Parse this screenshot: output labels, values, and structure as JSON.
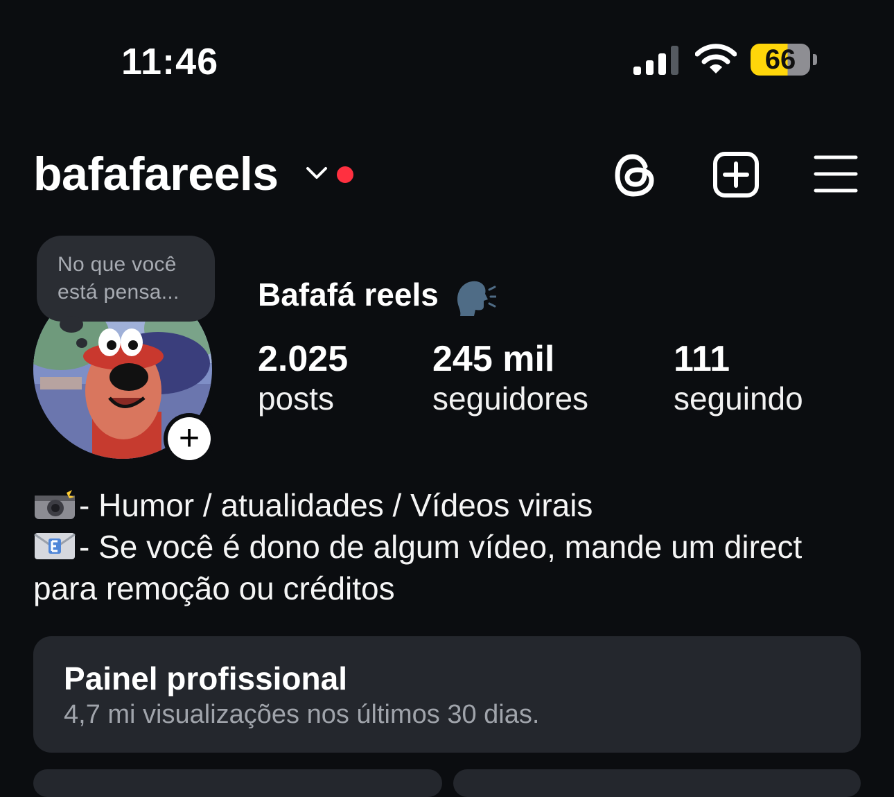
{
  "status_bar": {
    "time": "11:46",
    "battery_level": "66",
    "signal_icon": "cellular-signal-icon",
    "wifi_icon": "wifi-icon"
  },
  "header": {
    "username": "bafafareels",
    "icons": [
      "chevron-down-icon",
      "threads-icon",
      "create-post-icon",
      "menu-icon"
    ],
    "notification_color": "#ff3040"
  },
  "profile": {
    "note_line1": "No que você",
    "note_line2": "está pensa...",
    "display_name": "Bafafá reels",
    "stats": [
      {
        "value": "2.025",
        "label": "posts"
      },
      {
        "value": "245 mil",
        "label": "seguidores"
      },
      {
        "value": "111",
        "label": "seguindo"
      }
    ]
  },
  "bio": {
    "line1": "- Humor / atualidades / Vídeos virais",
    "line2": "- Se você é dono de algum vídeo, mande um direct",
    "line3": "para remoção ou créditos"
  },
  "professional_dashboard": {
    "title": "Painel profissional",
    "subtitle": "4,7 mi visualizações nos últimos 30 dias."
  },
  "colors": {
    "background": "#0b0d10",
    "card": "#24272d",
    "battery": "#ffd60a"
  }
}
